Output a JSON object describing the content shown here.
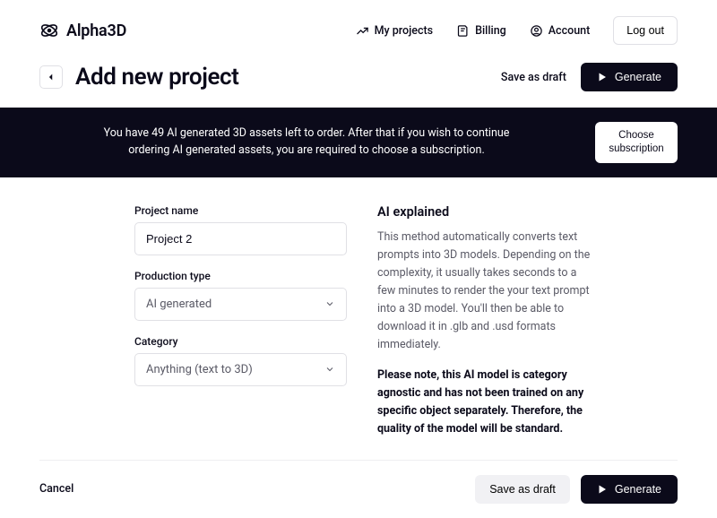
{
  "brand": "Alpha3D",
  "nav": {
    "projects": "My projects",
    "billing": "Billing",
    "account": "Account",
    "logout": "Log out"
  },
  "page": {
    "title": "Add new project",
    "save_draft": "Save as draft",
    "generate": "Generate"
  },
  "banner": {
    "text": "You have 49 AI generated 3D assets left to order. After that if you wish to continue ordering AI generated assets, you are required to choose a subscription.",
    "button_l1": "Choose",
    "button_l2": "subscription"
  },
  "form": {
    "project_name_label": "Project name",
    "project_name_value": "Project 2",
    "production_type_label": "Production type",
    "production_type_value": "AI generated",
    "category_label": "Category",
    "category_value": "Anything (text to 3D)"
  },
  "info": {
    "title": "AI explained",
    "text": "This method automatically converts text prompts into 3D models. Depending on the complexity, it usually takes seconds to a few minutes to render the your text prompt into a 3D model. You'll then be able to download it in .glb and .usd formats immediately.",
    "note": "Please note, this AI model is category agnostic and has not been trained on any specific object separately. Therefore, the quality of the model will be standard."
  },
  "footer": {
    "cancel": "Cancel",
    "save_draft": "Save as draft",
    "generate": "Generate"
  }
}
